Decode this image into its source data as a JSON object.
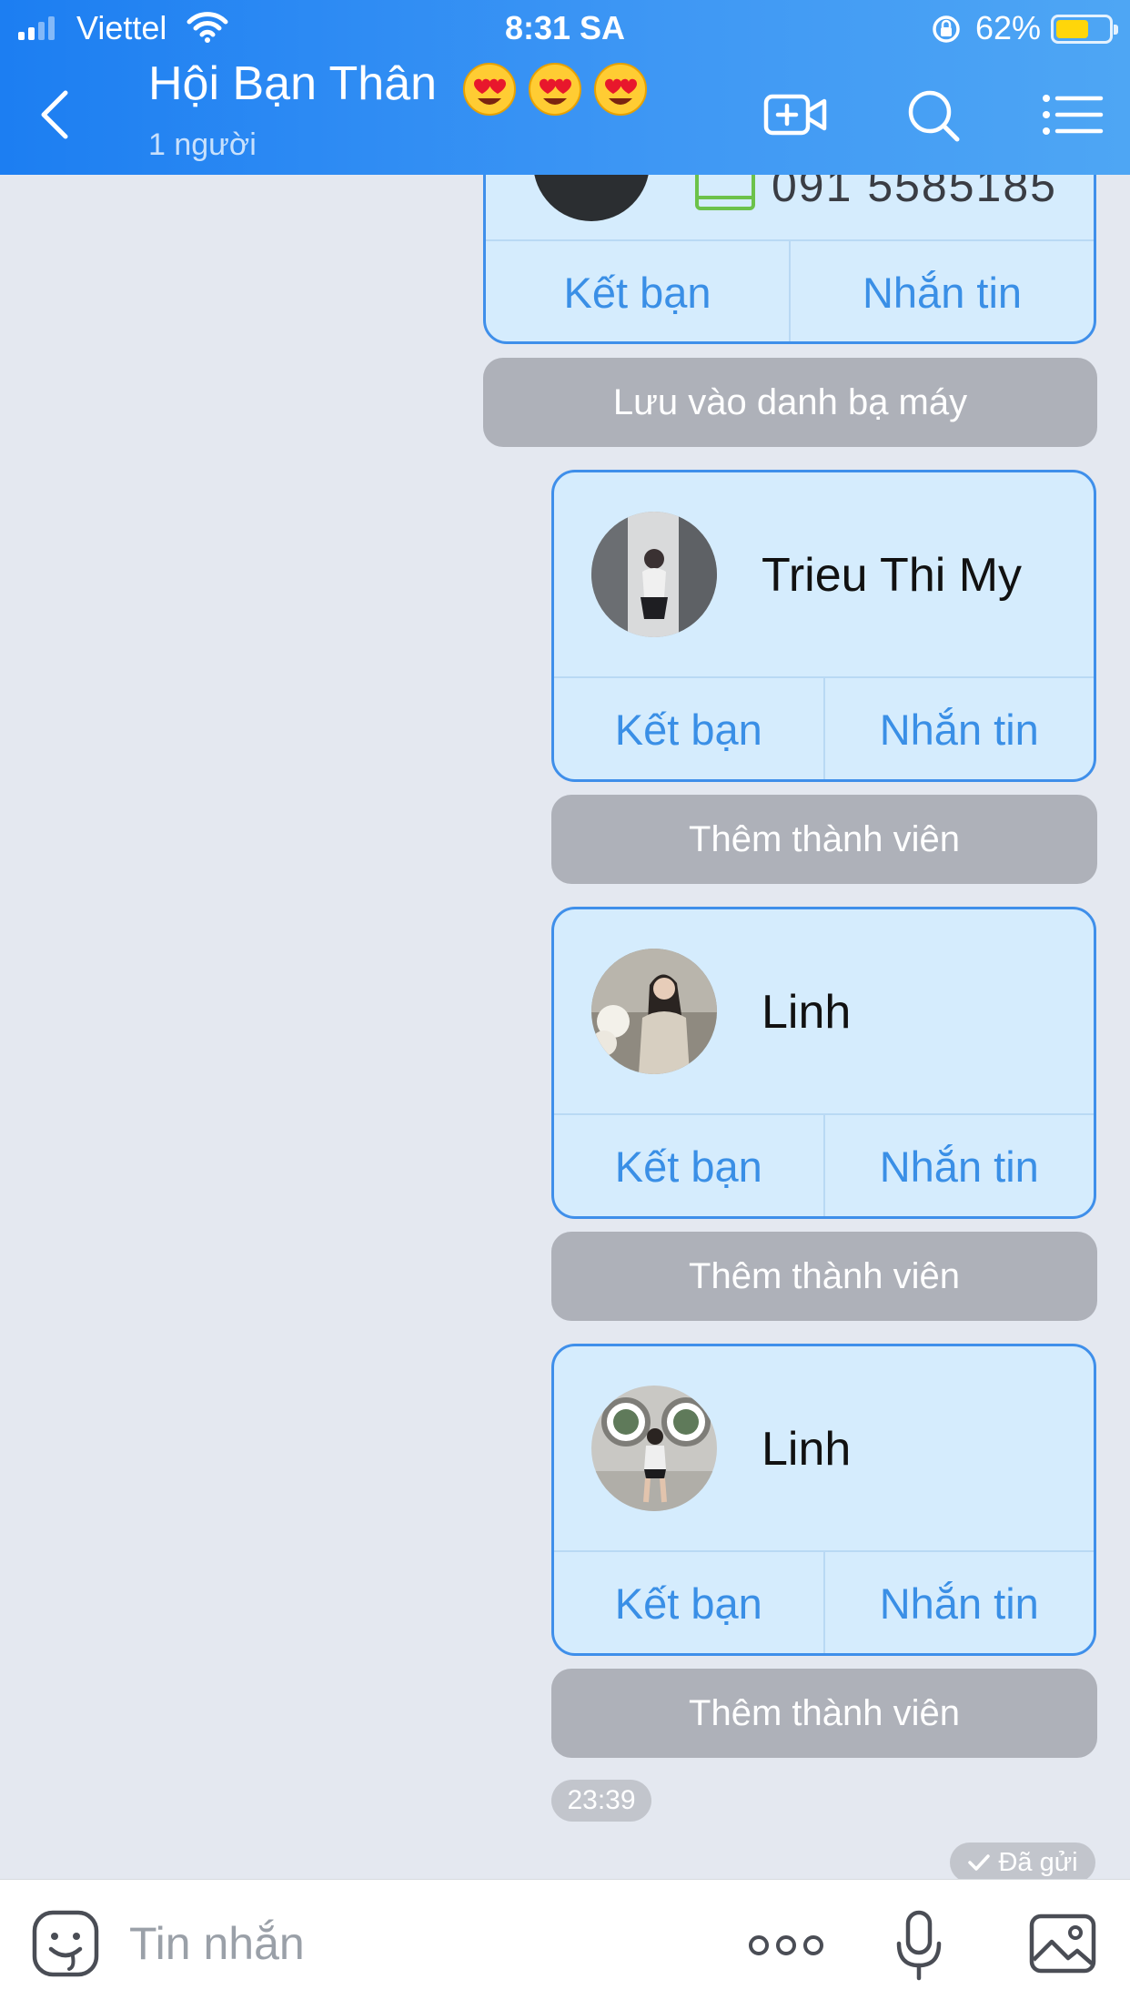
{
  "status_bar": {
    "carrier": "Viettel",
    "time": "8:31 SA",
    "battery": "62%",
    "battery_level": 0.62
  },
  "header": {
    "title": "Hội Bạn Thân",
    "emojis": [
      "heart-eyes-emoji",
      "heart-eyes-emoji",
      "heart-eyes-emoji"
    ],
    "subtitle": "1 người",
    "icons": [
      "back-icon",
      "video-call-icon",
      "search-icon",
      "menu-icon"
    ]
  },
  "messages": {
    "partial_card": {
      "phone": "091 5585185",
      "add_friend": "Kết bạn",
      "message": "Nhắn tin",
      "save_contact": "Lưu vào danh bạ máy"
    },
    "cards": [
      {
        "name": "Trieu Thi My",
        "add_friend": "Kết bạn",
        "message": "Nhắn tin",
        "add_member": "Thêm thành viên"
      },
      {
        "name": "Linh",
        "add_friend": "Kết bạn",
        "message": "Nhắn tin",
        "add_member": "Thêm thành viên"
      },
      {
        "name": "Linh",
        "add_friend": "Kết bạn",
        "message": "Nhắn tin",
        "add_member": "Thêm thành viên"
      }
    ],
    "time": "23:39",
    "status": "Đã gửi"
  },
  "composer": {
    "placeholder": "Tin nhắn",
    "icons": [
      "sticker-icon",
      "more-icon",
      "microphone-icon",
      "image-icon"
    ]
  },
  "colors": {
    "header": "#2e8af3",
    "card_bg": "#d5ecfd",
    "card_border": "#3f8fea",
    "link": "#3a8fe6",
    "gray_button": "#aeb1b9",
    "chat_bg": "#e4e8f0"
  }
}
